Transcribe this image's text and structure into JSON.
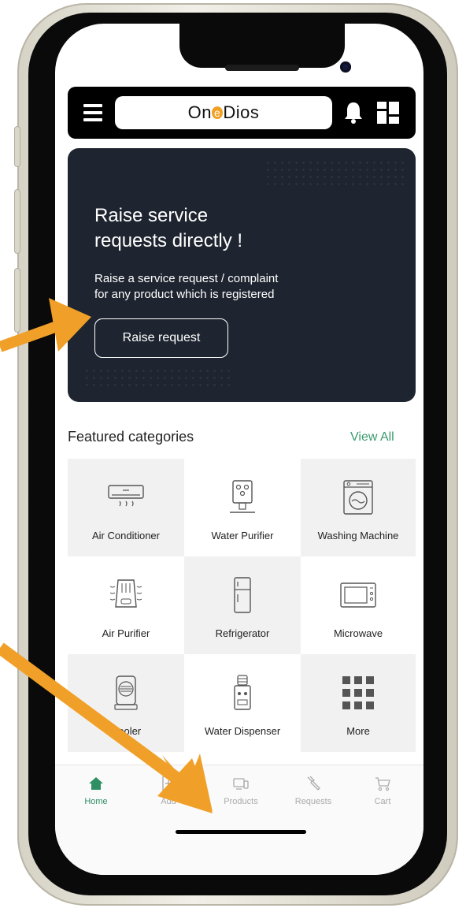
{
  "header": {
    "logo_text_pre": "On",
    "logo_text_e": "e",
    "logo_text_post": "Dios"
  },
  "banner": {
    "title_line1": "Raise service",
    "title_line2": "requests directly !",
    "subtitle_line1": "Raise a service request / complaint",
    "subtitle_line2": "for any product which is registered",
    "button_label": "Raise request"
  },
  "featured": {
    "title": "Featured categories",
    "view_all": "View All",
    "categories": [
      {
        "label": "Air Conditioner"
      },
      {
        "label": "Water Purifier"
      },
      {
        "label": "Washing Machine"
      },
      {
        "label": "Air Purifier"
      },
      {
        "label": "Refrigerator"
      },
      {
        "label": "Microwave"
      },
      {
        "label": "Cooler"
      },
      {
        "label": "Water Dispenser"
      },
      {
        "label": "More"
      }
    ]
  },
  "bottom_nav": {
    "items": [
      {
        "label": "Home"
      },
      {
        "label": "Add"
      },
      {
        "label": "Products"
      },
      {
        "label": "Requests"
      },
      {
        "label": "Cart"
      }
    ]
  },
  "colors": {
    "accent_green": "#3b9b6e",
    "banner_bg": "#1f2530",
    "arrow_orange": "#f0a028",
    "logo_orange": "#f2a024"
  }
}
